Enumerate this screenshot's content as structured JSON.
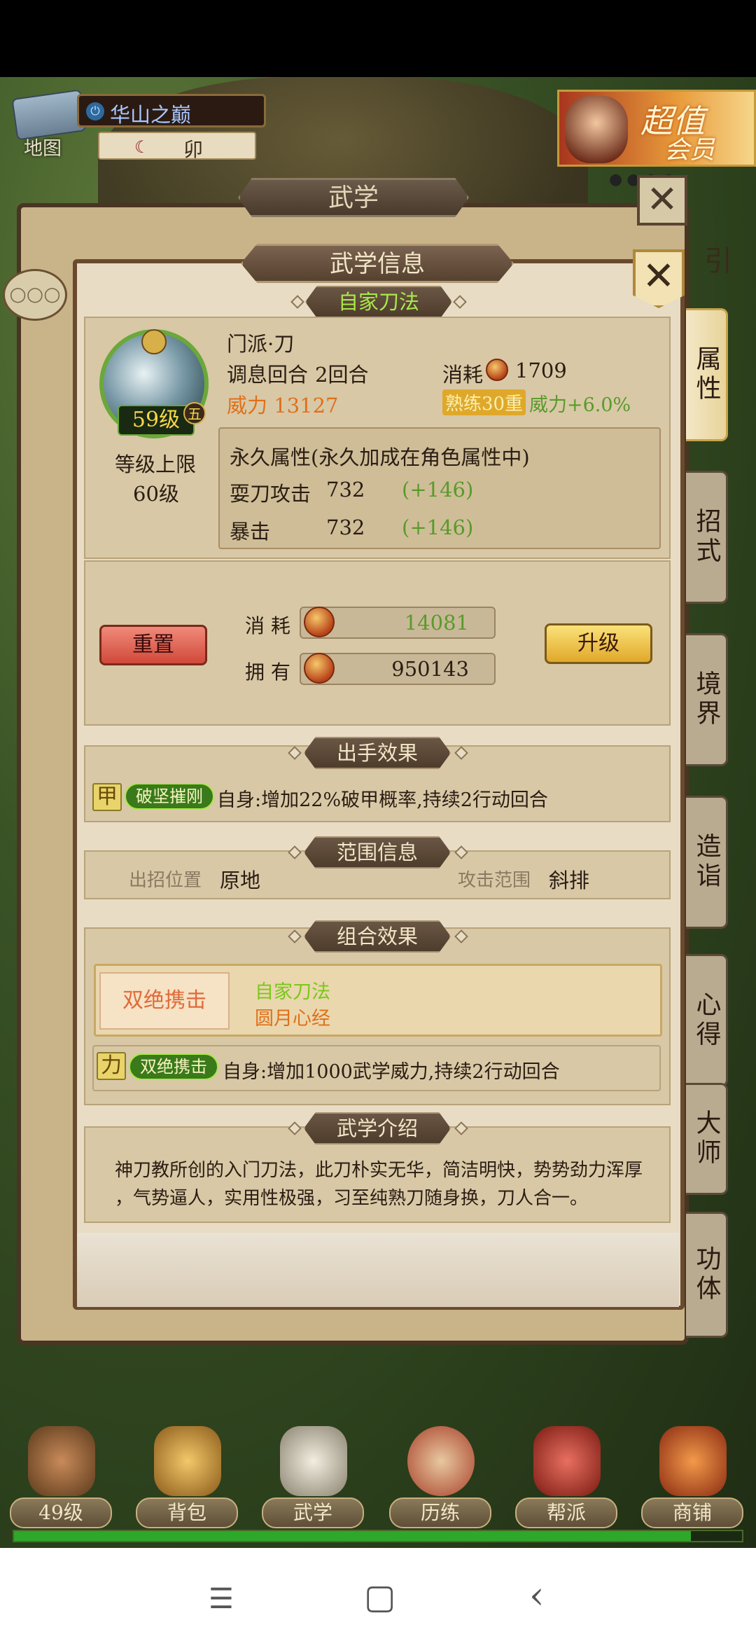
{
  "map": {
    "label": "地图",
    "location": "华山之巅",
    "time": "卯"
  },
  "vip": {
    "title": "超值",
    "subtitle": "会员"
  },
  "outer_panel": {
    "title": "武学"
  },
  "side_tabs": [
    "属性",
    "招式",
    "境界",
    "造诣",
    "心得",
    "大师",
    "功体"
  ],
  "side_guide": "引",
  "modal": {
    "title": "武学信息",
    "school_title": "自家刀法",
    "skill": {
      "type": "门派·刀",
      "adjust_label": "调息回合",
      "adjust_value": "2回合",
      "cost_label": "消耗",
      "cost_value": "1709",
      "power": "威力 13127",
      "proficiency": "熟练30重",
      "power_bonus": "威力+6.0%",
      "level": "59级",
      "tier": "五",
      "level_cap_label": "等级上限",
      "level_cap_value": "60级"
    },
    "permanent": {
      "title": "永久属性(永久加成在角色属性中)",
      "rows": [
        {
          "name": "耍刀攻击",
          "value": "732",
          "bonus": "(+146)"
        },
        {
          "name": "暴击",
          "value": "732",
          "bonus": "(+146)"
        }
      ]
    },
    "upgrade": {
      "reset_label": "重置",
      "upgrade_label": "升级",
      "cost_label": "消 耗",
      "cost_value": "14081",
      "own_label": "拥 有",
      "own_value": "950143"
    },
    "effect": {
      "title": "出手效果",
      "tag": "甲",
      "name": "破坚摧刚",
      "desc": "自身:增加22%破甲概率,持续2行动回合"
    },
    "range": {
      "title": "范围信息",
      "pos_label": "出招位置",
      "pos_value": "原地",
      "atk_label": "攻击范围",
      "atk_value": "斜排"
    },
    "combo": {
      "title": "组合效果",
      "badge": "双绝携击",
      "skill1": "自家刀法",
      "skill2": "圆月心经",
      "tag": "力",
      "name": "双绝携击",
      "desc": "自身:增加1000武学威力,持续2行动回合"
    },
    "intro": {
      "title": "武学介绍",
      "line1": "神刀教所创的入门刀法，此刀朴实无华，简洁明快，势势劲力浑厚",
      "line2": "，气势逼人，实用性极强，习至纯熟刀随身换，刀人合一。"
    }
  },
  "bottom_nav": [
    {
      "label": "49级",
      "icon": "character-icon",
      "color": "#c98a5a"
    },
    {
      "label": "背包",
      "icon": "bag-icon",
      "color": "#d8a84a"
    },
    {
      "label": "武学",
      "icon": "scroll-icon",
      "color": "#e8e2d0"
    },
    {
      "label": "历练",
      "icon": "drum-icon",
      "color": "#c0503a"
    },
    {
      "label": "帮派",
      "icon": "banner-icon",
      "color": "#b8382a"
    },
    {
      "label": "商铺",
      "icon": "shop-icon",
      "color": "#d86a2a"
    }
  ],
  "exp_progress": 0.93,
  "system_nav": {
    "menu": "☰",
    "home": "▢",
    "back": "‹"
  }
}
